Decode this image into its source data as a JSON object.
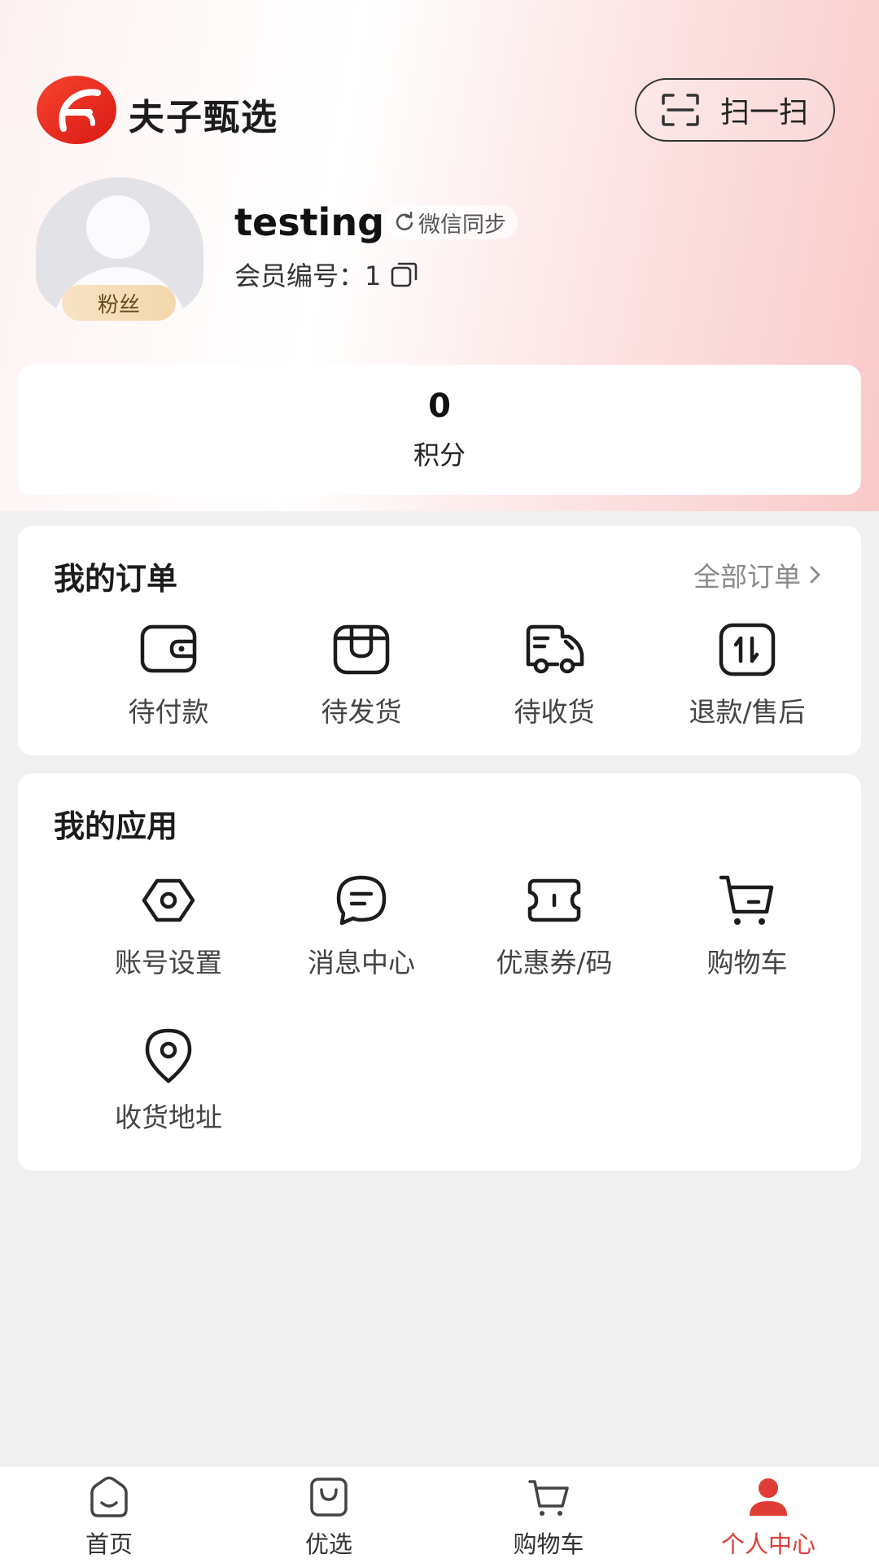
{
  "header": {
    "brand_name": "夫子甄选",
    "scan_label": "扫一扫"
  },
  "profile": {
    "username": "testing",
    "wechat_sync_label": "微信同步",
    "member_label": "会员编号：",
    "member_id": "1",
    "badge": "粉丝"
  },
  "points": {
    "value": "0",
    "label": "积分"
  },
  "orders": {
    "title": "我的订单",
    "all_label": "全部订单",
    "items": [
      {
        "label": "待付款",
        "icon": "wallet-icon"
      },
      {
        "label": "待发货",
        "icon": "package-icon"
      },
      {
        "label": "待收货",
        "icon": "truck-icon"
      },
      {
        "label": "退款/售后",
        "icon": "refund-icon"
      }
    ]
  },
  "apps": {
    "title": "我的应用",
    "items": [
      {
        "label": "账号设置",
        "icon": "settings-icon"
      },
      {
        "label": "消息中心",
        "icon": "message-icon"
      },
      {
        "label": "优惠券/码",
        "icon": "coupon-icon"
      },
      {
        "label": "购物车",
        "icon": "cart-icon"
      },
      {
        "label": "收货地址",
        "icon": "location-icon"
      }
    ]
  },
  "tabbar": {
    "items": [
      {
        "label": "首页",
        "icon": "home-icon"
      },
      {
        "label": "优选",
        "icon": "shopping-bag-icon"
      },
      {
        "label": "购物车",
        "icon": "cart-icon"
      },
      {
        "label": "个人中心",
        "icon": "user-icon"
      }
    ],
    "active_index": 3
  },
  "colors": {
    "accent": "#e03c36",
    "background": "#f1f0f1",
    "badge": "#f3d7ad"
  }
}
